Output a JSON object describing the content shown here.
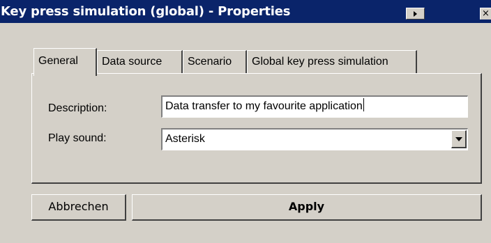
{
  "window": {
    "title": "Key press simulation (global) - Properties",
    "menu_icon": "triangle-right-icon",
    "close_label": "×"
  },
  "tabs": [
    {
      "label": "General",
      "active": true
    },
    {
      "label": "Data source",
      "active": false
    },
    {
      "label": "Scenario",
      "active": false
    },
    {
      "label": "Global key press simulation",
      "active": false
    }
  ],
  "form": {
    "description_label": "Description:",
    "description_value": "Data transfer to my favourite application",
    "sound_label": "Play sound:",
    "sound_value": "Asterisk"
  },
  "buttons": {
    "cancel": "Abbrechen",
    "apply": "Apply"
  },
  "colors": {
    "titlebar": "#0a246a",
    "face": "#d4d0c8"
  }
}
